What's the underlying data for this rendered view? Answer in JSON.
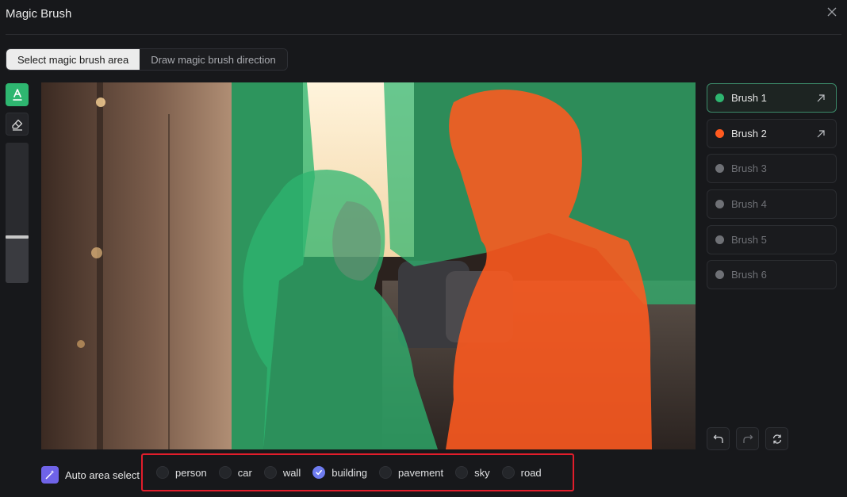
{
  "window": {
    "title": "Magic Brush",
    "close_icon": "close-icon"
  },
  "tabs": [
    {
      "label": "Select magic brush area",
      "active": true
    },
    {
      "label": "Draw magic brush direction",
      "active": false
    }
  ],
  "tools": {
    "brush_icon": "brush-tool-icon",
    "eraser_icon": "eraser-icon",
    "brush_size_level": 0.33
  },
  "brushes": [
    {
      "label": "Brush 1",
      "color": "#2eb670",
      "enabled": true,
      "selected": true
    },
    {
      "label": "Brush 2",
      "color": "#ff5a1f",
      "enabled": true,
      "selected": false
    },
    {
      "label": "Brush 3",
      "color": "#6f7176",
      "enabled": false,
      "selected": false
    },
    {
      "label": "Brush 4",
      "color": "#6f7176",
      "enabled": false,
      "selected": false
    },
    {
      "label": "Brush 5",
      "color": "#6f7176",
      "enabled": false,
      "selected": false
    },
    {
      "label": "Brush 6",
      "color": "#6f7176",
      "enabled": false,
      "selected": false
    }
  ],
  "history": {
    "undo_icon": "undo-icon",
    "redo_icon": "redo-icon",
    "reset_icon": "reset-icon"
  },
  "auto_select": {
    "label": "Auto area select",
    "icon": "magic-wand-icon",
    "accent": "#6f63e8"
  },
  "categories": [
    {
      "label": "person",
      "checked": false
    },
    {
      "label": "car",
      "checked": false
    },
    {
      "label": "wall",
      "checked": false
    },
    {
      "label": "building",
      "checked": true
    },
    {
      "label": "pavement",
      "checked": false
    },
    {
      "label": "sky",
      "checked": false
    },
    {
      "label": "road",
      "checked": false
    }
  ],
  "colors": {
    "brush1_overlay": "#2eb670",
    "brush2_overlay": "#ff5a1f",
    "highlight_border": "#e11d2b"
  }
}
